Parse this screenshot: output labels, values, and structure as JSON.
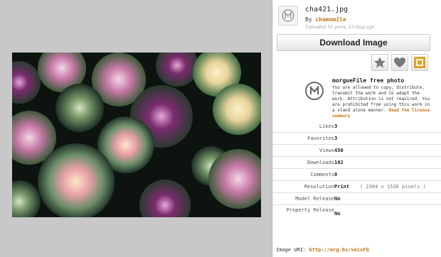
{
  "file": {
    "name": "cha421.jpg",
    "by_prefix": "By",
    "author": "chamomile",
    "uploaded": "Uploaded 10 years, 23 days ago"
  },
  "download_label": "Download Image",
  "actions": {
    "star_icon": "star-icon",
    "heart_icon": "heart-icon",
    "frame_icon": "frame-icon"
  },
  "free_photo": {
    "title": "morgueFile free photo",
    "text": "You are allowed to copy, distribute, transmit the work and to adapt the work. Attribution is not required. You are prohibited from using this work in a stand alone manner.",
    "license_link": "Read the license summary"
  },
  "stats": [
    {
      "key": "Likes",
      "value": "3"
    },
    {
      "key": "Favorites",
      "value": "3"
    },
    {
      "key": "Views",
      "value": "450"
    },
    {
      "key": "Downloads",
      "value": "102"
    },
    {
      "key": "Comments",
      "value": "0"
    },
    {
      "key": "Resolution",
      "value": "Print",
      "extra": "( 2304 x 1536 pixels )"
    },
    {
      "key": "Model Release",
      "value": "No"
    },
    {
      "key": "Property Release",
      "value": "No"
    }
  ],
  "uri": {
    "label": "Image URI:",
    "link": "http://mrg.bz/ve1xFQ"
  },
  "colors": {
    "accent": "#c8741a",
    "left_bg": "#c8c8c8",
    "right_bg": "#ffffff"
  }
}
